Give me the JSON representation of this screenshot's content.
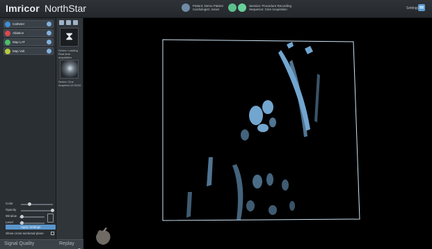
{
  "app": {
    "brand": "Imricor",
    "product": "NorthStar"
  },
  "header": {
    "user_line1": "Patient: Demo Patient",
    "user_line2": "Cardiologist: Jones",
    "session_line1": "Session: Procedure Recording",
    "session_line2": "Sequence: Cine Acquisition",
    "settings_label": "Settings"
  },
  "objects": [
    {
      "label": "Catheter",
      "color": "#3f8fd6"
    },
    {
      "label": "Ablation",
      "color": "#d84b4b"
    },
    {
      "label": "Map LAT",
      "color": "#4bbf6a"
    },
    {
      "label": "Map Volt",
      "color": "#b8cc3a"
    }
  ],
  "controls": {
    "color_label": "Color",
    "opacity_label": "Opacity",
    "window_label": "Window",
    "level_label": "Level",
    "apply_button": "Apply Settings",
    "option_label": "Show cross-sectional plane",
    "signal_quality": "Signal Quality"
  },
  "series": {
    "thumb1_caption_line1": "Series: Loading",
    "thumb1_caption_line2": "Real-time acquisition",
    "thumb2_caption_line1": "Series: Cine",
    "thumb2_caption_line2": "Acquired 12:00:52",
    "replay_label": "Replay"
  }
}
